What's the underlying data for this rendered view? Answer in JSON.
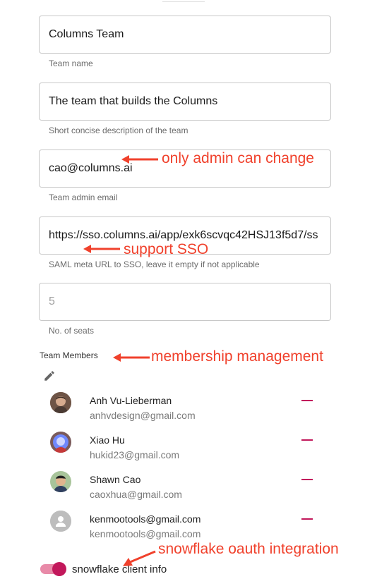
{
  "fields": {
    "team_name": {
      "value": "Columns Team",
      "helper": "Team name"
    },
    "description": {
      "value": "The team that builds the Columns",
      "helper": "Short concise description of the team"
    },
    "admin_email": {
      "value": "cao@columns.ai",
      "helper": "Team admin email"
    },
    "sso_url": {
      "value": "https://sso.columns.ai/app/exk6scvqc42HSJ13f5d7/ss",
      "helper": "SAML meta URL to SSO, leave it empty if not applicable"
    },
    "seats": {
      "value": "5",
      "helper": "No. of seats"
    }
  },
  "members_section": {
    "label": "Team Members"
  },
  "members": [
    {
      "name": "Anh Vu-Lieberman",
      "email": "anhvdesign@gmail.com",
      "avatar": "photo"
    },
    {
      "name": "Xiao Hu",
      "email": "hukid23@gmail.com",
      "avatar": "photo"
    },
    {
      "name": "Shawn Cao",
      "email": "caoxhua@gmail.com",
      "avatar": "photo"
    },
    {
      "name": "kenmootools@gmail.com",
      "email": "kenmootools@gmail.com",
      "avatar": "default-person-icon"
    }
  ],
  "toggle": {
    "label": "snowflake client info",
    "on": true
  },
  "annotations": {
    "admin": "only admin can change",
    "sso": "support SSO",
    "membership": "membership management",
    "oauth": "snowflake oauth integration"
  },
  "colors": {
    "annotation": "#f0412c",
    "accent": "#c2185b",
    "accent_track": "#e88aa8"
  }
}
